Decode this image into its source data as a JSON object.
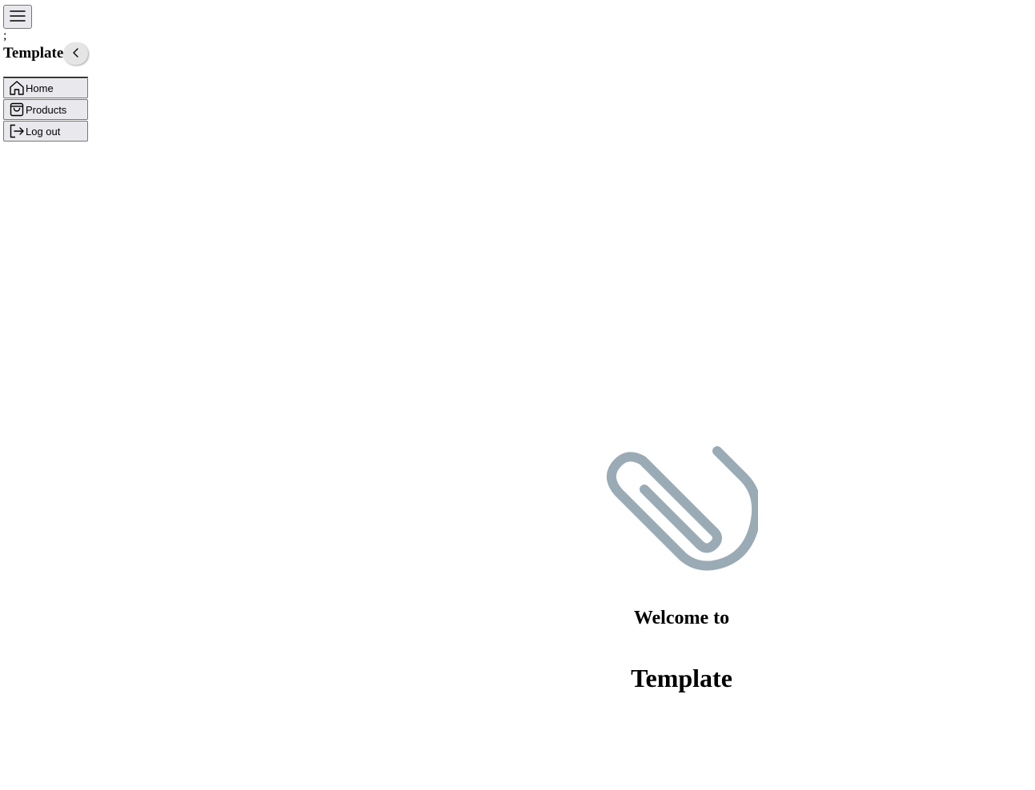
{
  "topbar": {
    "menu_icon": "hamburger-menu-icon"
  },
  "stray_text": ";",
  "sidebar": {
    "title": "Template",
    "collapse_icon": "chevron-left-icon",
    "items": [
      {
        "label": "Home",
        "icon": "home-icon"
      },
      {
        "label": "Products",
        "icon": "shopping-bag-icon"
      },
      {
        "label": "Log out",
        "icon": "logout-icon"
      }
    ]
  },
  "main": {
    "hero_icon": "paperclip-icon",
    "hero_icon_color": "#9aabb6",
    "welcome": "Welcome to",
    "brand": "Template"
  }
}
